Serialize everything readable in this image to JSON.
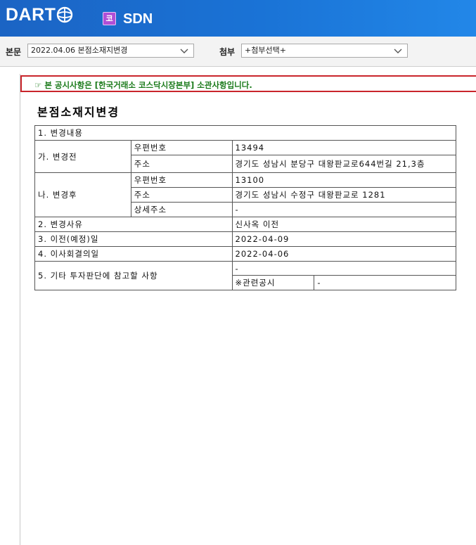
{
  "header": {
    "logo_text": "DART",
    "market_badge": "코",
    "app_name": "SDN"
  },
  "toolbar": {
    "body_label": "본문",
    "body_selected": "2022.04.06  본점소재지변경",
    "attach_label": "첨부",
    "attach_selected": "+첨부선택+"
  },
  "notice": {
    "text": "☞ 본 공시사항은 [한국거래소 코스닥시장본부] 소관사항입니다."
  },
  "document": {
    "title": "본점소재지변경",
    "section1": "1. 변경내용",
    "before": {
      "label": "가. 변경전",
      "zip_label": "우편번호",
      "zip_value": "13494",
      "addr_label": "주소",
      "addr_value": "경기도 성남시 분당구 대왕판교로644번길 21,3층"
    },
    "after": {
      "label": "나. 변경후",
      "zip_label": "우편번호",
      "zip_value": "13100",
      "addr_label": "주소",
      "addr_value": "경기도 성남시 수정구 대왕판교로 1281",
      "detail_label": "상세주소",
      "detail_value": "-"
    },
    "reason_label": "2. 변경사유",
    "reason_value": "신사옥 이전",
    "move_date_label": "3. 이전(예정)일",
    "move_date_value": "2022-04-09",
    "board_date_label": "4. 이사회결의일",
    "board_date_value": "2022-04-06",
    "other_label": "5. 기타 투자판단에 참고할 사항",
    "other_value": "-",
    "related_label": "※관련공시",
    "related_value": "-"
  },
  "colors": {
    "header_blue": "#1a73d6",
    "notice_border": "#c9252b",
    "notice_text": "#1a7a1a",
    "badge_purple": "#b04fd6"
  }
}
